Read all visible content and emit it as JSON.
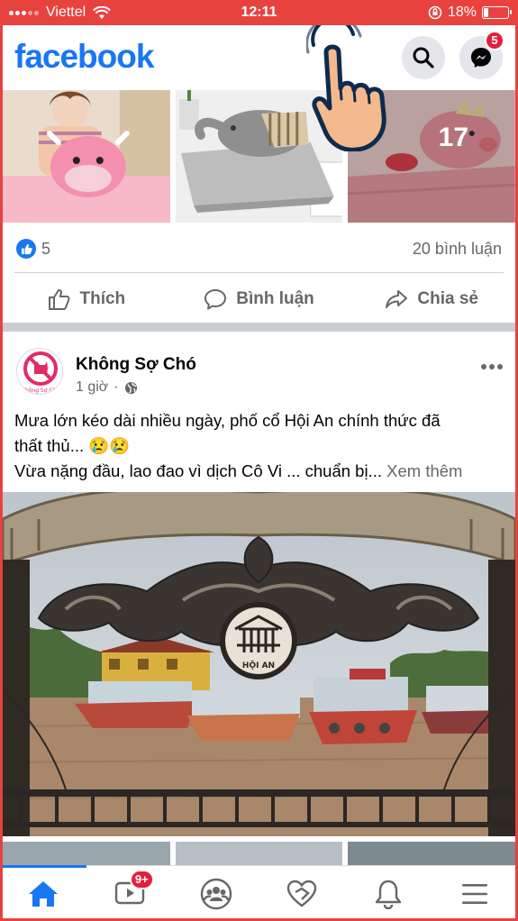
{
  "status_bar": {
    "carrier": "Viettel",
    "time": "12:11",
    "battery": "18%",
    "battery_level": 0.18
  },
  "header": {
    "logo": "facebook",
    "search_icon": "search-icon",
    "messenger_icon": "messenger-icon",
    "messenger_badge": "5"
  },
  "previous_post": {
    "photo_count_overlay": "17",
    "like_count": "5",
    "comment_count": "20 bình luận",
    "actions": {
      "like": "Thích",
      "comment": "Bình luận",
      "share": "Chia sẻ"
    }
  },
  "post": {
    "page_name": "Không Sợ Chó",
    "time": "1 giờ",
    "separator": "·",
    "text_line1": "Mưa lớn kéo dài nhiều ngày, phố cổ Hội An chính thức đã",
    "text_line2": "thất thủ... 😢😢",
    "text_line3": "Vừa nặng đầu, lao đao vì dịch Cô Vi ... chuẩn bị... ",
    "see_more": "Xem thêm",
    "image_sign_text": "HỘI AN",
    "avatar_text": "Không Sợ Chó"
  },
  "tab_bar": {
    "tabs": [
      "home-icon",
      "watch-icon",
      "groups-icon",
      "dating-icon",
      "notifications-icon",
      "menu-icon"
    ],
    "watch_badge": "9+"
  },
  "colors": {
    "brand": "#1877f2",
    "status_bar": "#e8423f",
    "badge": "#e41e3f",
    "secondary_text": "#65676b"
  }
}
